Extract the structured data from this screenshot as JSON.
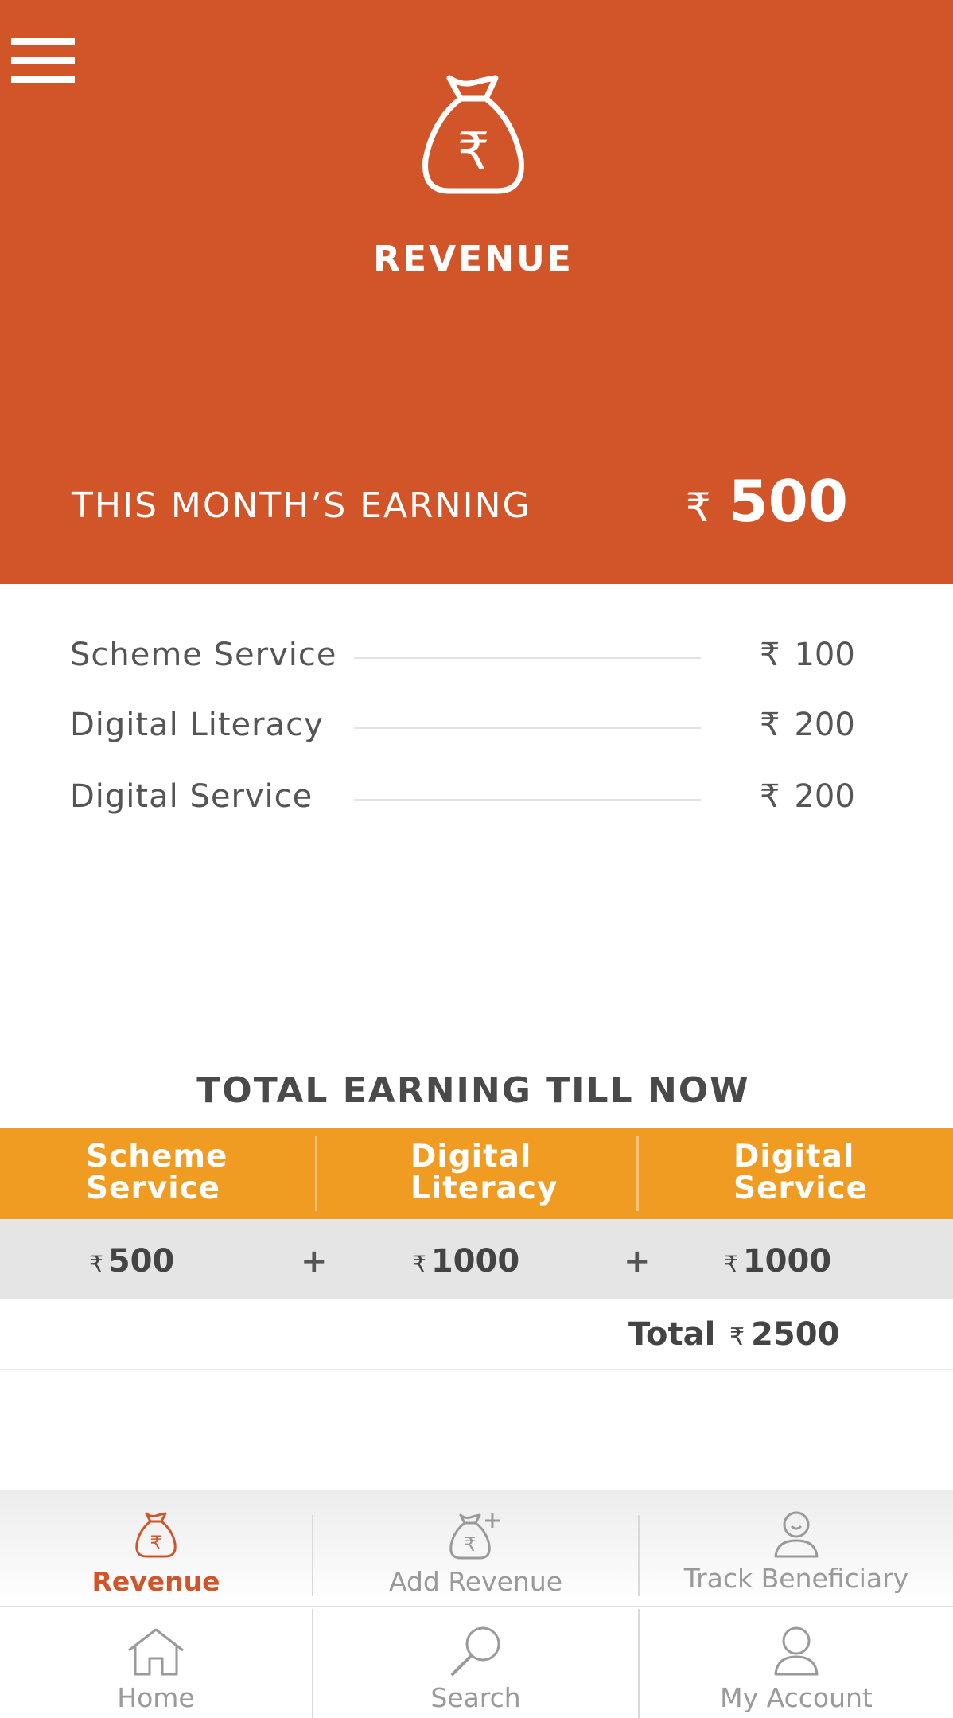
{
  "header": {
    "title": "REVENUE",
    "icon": "money-bag-rupee-icon",
    "menu_icon": "hamburger-menu-icon",
    "month_label": "THIS MONTH’S EARNING",
    "currency": "₹",
    "month_amount": "500",
    "background_color": "#d15528"
  },
  "breakdown": [
    {
      "label": "Scheme Service",
      "currency": "₹",
      "amount": "100"
    },
    {
      "label": "Digital Literacy",
      "currency": "₹",
      "amount": "200"
    },
    {
      "label": "Digital Service",
      "currency": "₹",
      "amount": "200"
    }
  ],
  "total_section": {
    "heading": "TOTAL EARNING TILL NOW",
    "columns": [
      {
        "line1": "Scheme",
        "line2": "Service",
        "currency": "₹",
        "amount": "500"
      },
      {
        "line1": "Digital",
        "line2": "Literacy",
        "currency": "₹",
        "amount": "1000"
      },
      {
        "line1": "Digital",
        "line2": "Service",
        "currency": "₹",
        "amount": "1000"
      }
    ],
    "operator": "+",
    "total_label": "Total",
    "total_currency": "₹",
    "total_amount": "2500",
    "header_color": "#f09c22"
  },
  "tabs": [
    {
      "label": "Revenue",
      "icon": "money-bag-icon",
      "active": true
    },
    {
      "label": "Add Revenue",
      "icon": "add-revenue-icon",
      "active": false
    },
    {
      "label": "Track Beneficiary",
      "icon": "beneficiary-icon",
      "active": false
    }
  ],
  "bottom_nav": [
    {
      "label": "Home",
      "icon": "home-icon"
    },
    {
      "label": "Search",
      "icon": "search-icon"
    },
    {
      "label": "My Account",
      "icon": "account-icon"
    }
  ]
}
